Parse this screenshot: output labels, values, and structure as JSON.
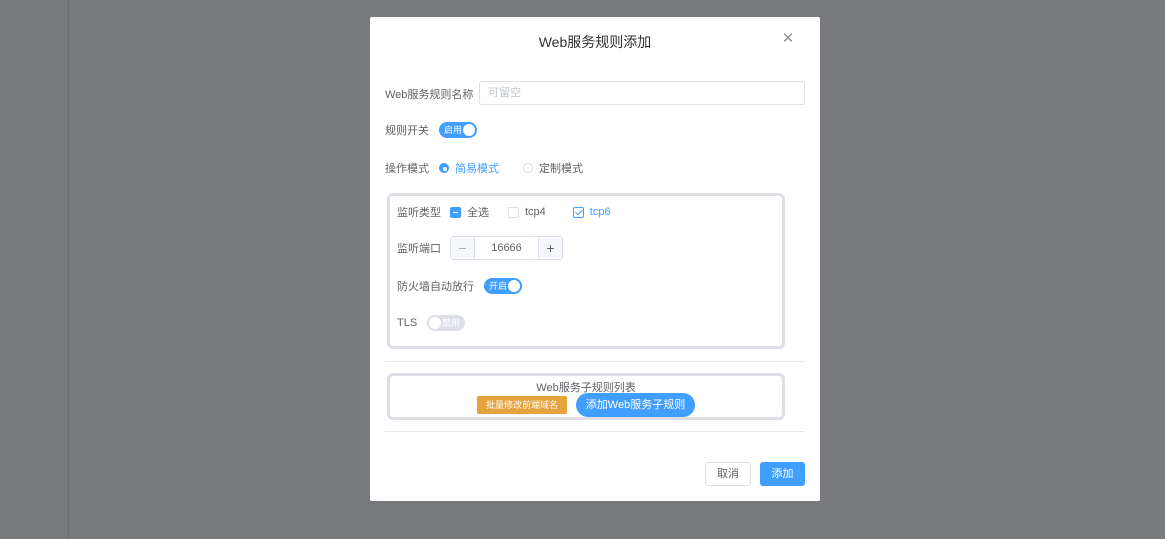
{
  "dialog": {
    "title": "Web服务规则添加",
    "close_icon": "close-icon"
  },
  "form": {
    "name_label": "Web服务规则名称",
    "name_value": "",
    "name_placeholder": "可留空",
    "switch_label": "规则开关",
    "switch_text": "启用",
    "switch_on": true,
    "mode_label": "操作模式",
    "mode_options": [
      "简易模式",
      "定制模式"
    ],
    "mode_selected": "简易模式"
  },
  "listen": {
    "type_label": "监听类型",
    "select_all": "全选",
    "tcp4": "tcp4",
    "tcp6": "tcp6",
    "tcp4_checked": false,
    "tcp6_checked": true,
    "port_label": "监听端口",
    "port_value": "16666",
    "firewall_label": "防火墙自动放行",
    "firewall_text": "开启",
    "firewall_on": true,
    "tls_label": "TLS",
    "tls_text": "禁用",
    "tls_on": false
  },
  "sub_rules": {
    "title": "Web服务子规则列表",
    "batch_button": "批量修改前端域名",
    "add_button": "添加Web服务子规则"
  },
  "footer": {
    "cancel": "取消",
    "confirm": "添加"
  },
  "colors": {
    "primary": "#409eff",
    "warning": "#e6a23c",
    "overlay": "#77797d"
  }
}
